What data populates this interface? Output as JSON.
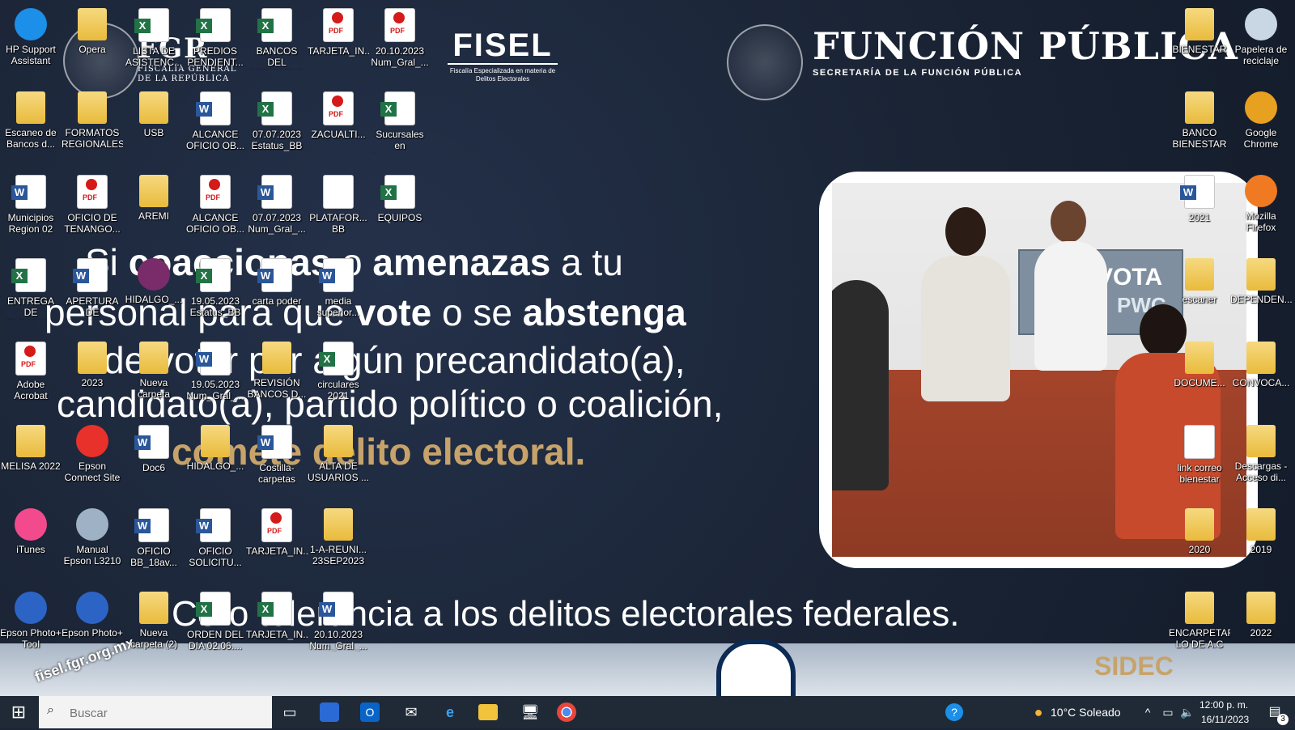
{
  "wallpaper": {
    "fgr": {
      "title": "FGR",
      "subtitle_line1": "FISCALÍA GENERAL",
      "subtitle_line2": "DE LA REPÚBLICA"
    },
    "fisel": {
      "title": "FISEL",
      "subtitle": "Fiscalía Especializada en materia de Delitos Electorales"
    },
    "funcion_publica": {
      "title": "FUNCIÓN PÚBLICA",
      "subtitle": "SECRETARÍA DE LA FUNCIÓN PÚBLICA"
    },
    "message": {
      "line1_a": "Si ",
      "line1_b": "coaccionas",
      "line1_c": " o ",
      "line1_d": "amenazas",
      "line1_e": " a tu",
      "line2_a": "personal para que ",
      "line2_b": "vote",
      "line2_c": " o se ",
      "line2_d": "abstenga",
      "line3": "de votar por algún precandidato(a),",
      "line4": "candidato(a), partido político o coalición,",
      "line5": "comete delito electoral."
    },
    "photo_sign": "VOTA",
    "photo_sign_small": "PWC",
    "zero_tolerance": "Cero tolerancia a los delitos electorales federales.",
    "sidec": "SIDEC",
    "url": "fisel.fgr.org.mx"
  },
  "desktop_icons": [
    {
      "label": "HP Support Assistant",
      "type": "app",
      "color": "#1c8fe8"
    },
    {
      "label": "Opera",
      "type": "folder"
    },
    {
      "label": "LISTA DE ASISTENC...",
      "type": "excel"
    },
    {
      "label": "PREDIOS PENDIENT...",
      "type": "excel"
    },
    {
      "label": "BANCOS DEL BIENESTAR ...",
      "type": "excel"
    },
    {
      "label": "TARJETA_IN...",
      "type": "pdf"
    },
    {
      "label": "20.10.2023 Num_Gral_...",
      "type": "pdf"
    },
    {
      "label": "Escaneo de Bancos d...",
      "type": "folder"
    },
    {
      "label": "FORMATOS REGIONALES",
      "type": "folder"
    },
    {
      "label": "USB",
      "type": "folder"
    },
    {
      "label": "ALCANCE OFICIO OB...",
      "type": "word"
    },
    {
      "label": "07.07.2023 Estatus_BB",
      "type": "excel"
    },
    {
      "label": "ZACUALTI...",
      "type": "pdf"
    },
    {
      "label": "Sucursales en funcionami...",
      "type": "excel"
    },
    {
      "label": "Municipios Region 02",
      "type": "word"
    },
    {
      "label": "OFICIO DE TENANGO...",
      "type": "pdf"
    },
    {
      "label": "AREMI",
      "type": "folder"
    },
    {
      "label": "ALCANCE OFICIO OB...",
      "type": "pdf"
    },
    {
      "label": "07.07.2023 Num_Gral_...",
      "type": "word"
    },
    {
      "label": "PLATAFOR... BB",
      "type": "doc"
    },
    {
      "label": "EQUIPOS",
      "type": "excel"
    },
    {
      "label": "ENTREGA DE TARJETAS F...",
      "type": "excel"
    },
    {
      "label": "APERTURA DE TARJETAS",
      "type": "word"
    },
    {
      "label": "HIDALGO_...",
      "type": "app",
      "color": "#7a2b6a"
    },
    {
      "label": "19.05.2023 Estatus_BB",
      "type": "excel"
    },
    {
      "label": "carta poder",
      "type": "word"
    },
    {
      "label": "media superior...",
      "type": "word"
    },
    {
      "label": "Adobe Acrobat",
      "type": "pdf"
    },
    {
      "label": "2023",
      "type": "folder"
    },
    {
      "label": "Nueva carpeta",
      "type": "folder"
    },
    {
      "label": "19.05.2023 Num_Gral_...",
      "type": "word"
    },
    {
      "label": "REVISIÓN BANCOS D...",
      "type": "folder"
    },
    {
      "label": "circulares 2021",
      "type": "excel"
    },
    {
      "label": "MELISA 2022",
      "type": "folder"
    },
    {
      "label": "Epson Connect Site",
      "type": "app",
      "color": "#e8312a"
    },
    {
      "label": "Doc6",
      "type": "word"
    },
    {
      "label": "HIDALGO_...",
      "type": "folder"
    },
    {
      "label": "Costilla-carpetas",
      "type": "word"
    },
    {
      "label": "ALTA DE USUARIOS ...",
      "type": "folder"
    },
    {
      "label": "iTunes",
      "type": "app",
      "color": "#f34a8e"
    },
    {
      "label": "Manual Epson L3210",
      "type": "app",
      "color": "#9fb1c4"
    },
    {
      "label": "OFICIO BB_18av...",
      "type": "word"
    },
    {
      "label": "OFICIO SOLICITU...",
      "type": "word"
    },
    {
      "label": "TARJETA_IN...",
      "type": "pdf"
    },
    {
      "label": "1-A-REUNI... 23SEP2023",
      "type": "folder"
    },
    {
      "label": "Epson Photo+ Tool",
      "type": "app",
      "color": "#2c64c6"
    },
    {
      "label": "Epson Photo+",
      "type": "app",
      "color": "#2c64c6"
    },
    {
      "label": "Nueva carpeta (2)",
      "type": "folder"
    },
    {
      "label": "ORDEN DEL DIA 02.06....",
      "type": "excel"
    },
    {
      "label": "TARJETA_IN...",
      "type": "excel"
    },
    {
      "label": "20.10.2023 Num_Gral_...",
      "type": "word"
    },
    {
      "label": "BIENESTAR",
      "type": "folder"
    },
    {
      "label": "Papelera de reciclaje",
      "type": "app",
      "color": "#c9d6e3"
    },
    {
      "label": "BANCO BIENESTAR",
      "type": "folder"
    },
    {
      "label": "Google Chrome",
      "type": "app",
      "color": "#e8a020"
    },
    {
      "label": "2021",
      "type": "word"
    },
    {
      "label": "Mozilla Firefox",
      "type": "app",
      "color": "#f07a21"
    },
    {
      "label": "escaner",
      "type": "folder"
    },
    {
      "label": "DEPENDEN...",
      "type": "folder"
    },
    {
      "label": "DOCUME...",
      "type": "folder"
    },
    {
      "label": "CONVOCA...",
      "type": "folder"
    },
    {
      "label": "link correo bienestar",
      "type": "doc"
    },
    {
      "label": "Descargas - Acceso di...",
      "type": "folder"
    },
    {
      "label": "2020",
      "type": "folder"
    },
    {
      "label": "2019",
      "type": "folder"
    },
    {
      "label": "ENCARPETAR LO DE A.C",
      "type": "folder"
    },
    {
      "label": "2022",
      "type": "folder"
    }
  ],
  "taskbar": {
    "start": "⊞",
    "search_placeholder": "Buscar",
    "apps": [
      "task-view",
      "store",
      "outlook",
      "mail",
      "edge",
      "file-explorer",
      "remote-desktop",
      "chrome"
    ],
    "weather": "10°C  Soleado",
    "time": "12:00 p. m.",
    "date": "16/11/2023",
    "notification_count": "3"
  }
}
